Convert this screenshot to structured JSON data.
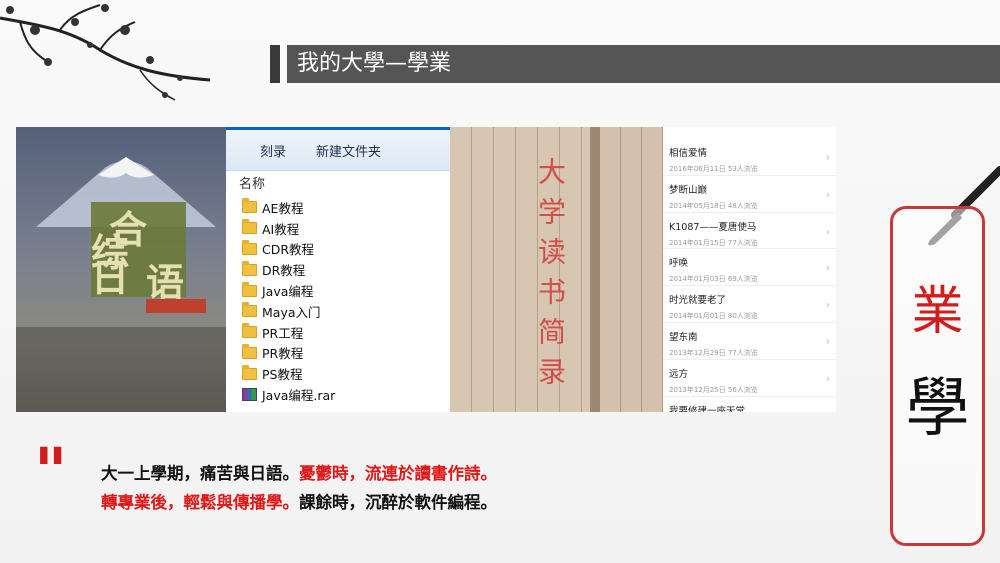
{
  "title": "我的大學—學業",
  "explorer": {
    "toolbar": [
      "刻录",
      "新建文件夹"
    ],
    "column_header": "名称",
    "files": [
      {
        "name": "AE教程",
        "type": "folder"
      },
      {
        "name": "AI教程",
        "type": "folder"
      },
      {
        "name": "CDR教程",
        "type": "folder"
      },
      {
        "name": "DR教程",
        "type": "folder"
      },
      {
        "name": "Java编程",
        "type": "folder"
      },
      {
        "name": "Maya入门",
        "type": "folder"
      },
      {
        "name": "PR工程",
        "type": "folder"
      },
      {
        "name": "PR教程",
        "type": "folder"
      },
      {
        "name": "PS教程",
        "type": "folder"
      },
      {
        "name": "Java编程.rar",
        "type": "archive"
      }
    ]
  },
  "book": {
    "chars": [
      "综",
      "合",
      "日",
      "语"
    ]
  },
  "notebook": {
    "red_text": "大学读书简录"
  },
  "phone": {
    "items": [
      {
        "title": "相信爱情",
        "date": "2016年06月11日",
        "views": "53人浏览"
      },
      {
        "title": "梦断山巅",
        "date": "2014年05月18日",
        "views": "48人浏览"
      },
      {
        "title": "K1087——夏唐使马",
        "date": "2014年01月15日",
        "views": "77人浏览"
      },
      {
        "title": "呼唤",
        "date": "2014年01月03日",
        "views": "69人浏览"
      },
      {
        "title": "时光就要老了",
        "date": "2014年01月01日",
        "views": "80人浏览"
      },
      {
        "title": "望东南",
        "date": "2013年12月29日",
        "views": "77人浏览"
      },
      {
        "title": "远方",
        "date": "2013年12月25日",
        "views": "56人浏览"
      },
      {
        "title": "我要修建一座天堂",
        "date": "",
        "views": ""
      }
    ]
  },
  "quote": {
    "mark": "\"",
    "line1_black": "大一上學期，痛苦與日語。",
    "line1_red": "憂鬱時，流連於讀書作詩。",
    "line2_red": "轉專業後，輕鬆與傳播學。",
    "line2_black": "課餘時，沉醉於軟件編程。"
  },
  "scroll": {
    "char_top": "業",
    "char_bottom": "學"
  },
  "colors": {
    "accent_red": "#d01c1c",
    "title_bar": "#555555"
  }
}
